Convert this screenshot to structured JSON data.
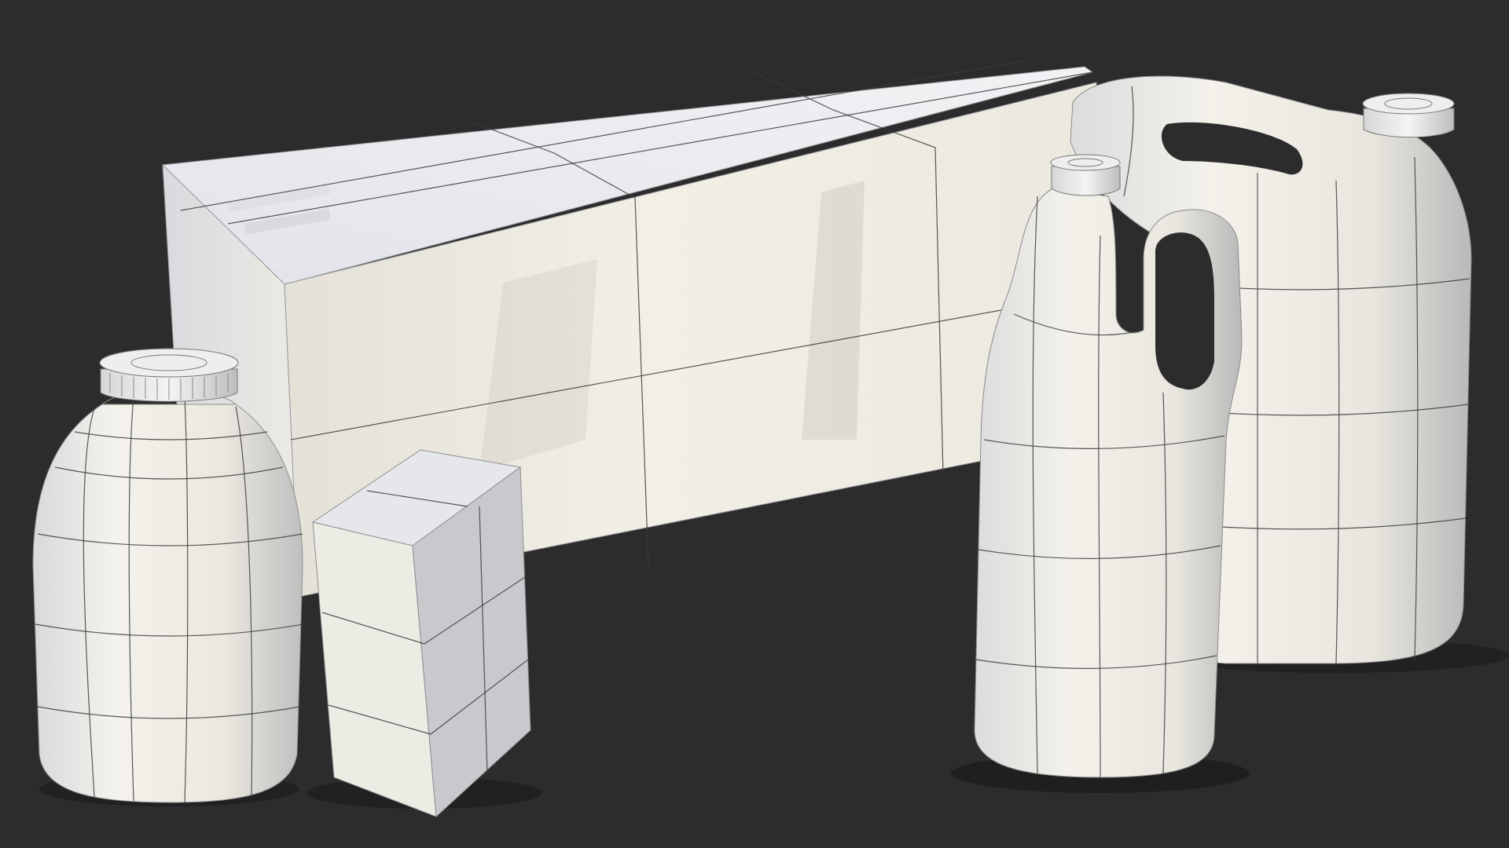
{
  "scene": {
    "background_color": "#2c2c2c",
    "object_base_color": "#efece4",
    "wire_color": "#3c3c3c",
    "objects": [
      {
        "name": "large-shipping-carton",
        "kind": "box"
      },
      {
        "name": "small-carton",
        "kind": "box"
      },
      {
        "name": "round-bottle",
        "kind": "bottle"
      },
      {
        "name": "handled-jug",
        "kind": "jug"
      },
      {
        "name": "canister",
        "kind": "canister"
      }
    ]
  }
}
